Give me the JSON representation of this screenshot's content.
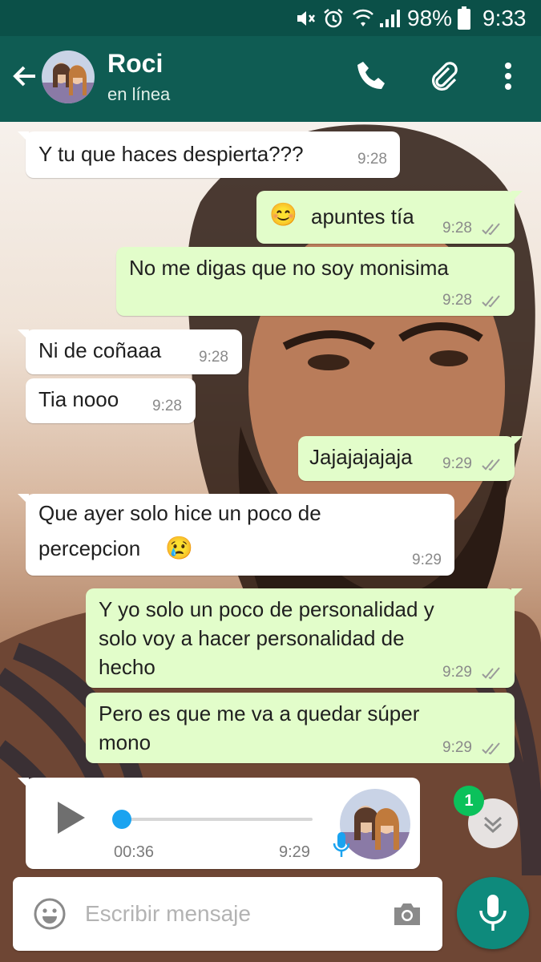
{
  "status_bar": {
    "battery": "98%",
    "time": "9:33"
  },
  "header": {
    "contact_name": "Roci",
    "contact_status": "en línea"
  },
  "messages": [
    {
      "dir": "in",
      "text": "Y tu que haces despierta???",
      "time": "9:28"
    },
    {
      "dir": "out",
      "emoji": "😊",
      "text": "apuntes tía",
      "time": "9:28"
    },
    {
      "dir": "out",
      "text": "No me digas que no soy monisima",
      "time": "9:28"
    },
    {
      "dir": "in",
      "text": "Ni de coñaaa",
      "time": "9:28"
    },
    {
      "dir": "in",
      "text": "Tia nooo",
      "time": "9:28"
    },
    {
      "dir": "out",
      "text": "Jajajajajaja",
      "time": "9:29"
    },
    {
      "dir": "in",
      "line1": "Que ayer solo hice un poco de",
      "line2": "percepcion",
      "emoji": "😢",
      "time": "9:29"
    },
    {
      "dir": "out",
      "line1": "Y yo solo un poco de personalidad y",
      "line2": "solo voy a hacer personalidad de",
      "line3": "hecho",
      "time": "9:29"
    },
    {
      "dir": "out",
      "line1": "Pero es que me va a quedar súper",
      "line2": "mono",
      "time": "9:29"
    }
  ],
  "voice_note": {
    "duration": "00:36",
    "time": "9:29",
    "progress": 0
  },
  "unread_count": "1",
  "composer": {
    "placeholder": "Escribir mensaje"
  },
  "colors": {
    "header": "#0f5c53",
    "out_bubble": "#e2fdca",
    "in_bubble": "#ffffff",
    "fab": "#0e8a7c",
    "badge": "#0bc15b",
    "progress": "#1aa3f0"
  }
}
